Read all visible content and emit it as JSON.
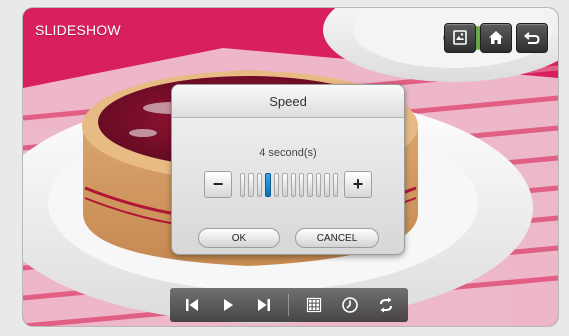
{
  "screen": {
    "title": "SLIDESHOW"
  },
  "top_buttons": [
    {
      "icon": "photo-frame-icon"
    },
    {
      "icon": "home-icon"
    },
    {
      "icon": "back-icon"
    }
  ],
  "speed_dialog": {
    "title": "Speed",
    "value_text": "4 second(s)",
    "minus_label": "−",
    "plus_label": "+",
    "level": 4,
    "level_max": 12,
    "ok_label": "OK",
    "cancel_label": "CANCEL"
  },
  "playback_bar": [
    {
      "icon": "previous-icon"
    },
    {
      "icon": "play-icon"
    },
    {
      "icon": "next-icon"
    },
    {
      "icon": "grid-icon"
    },
    {
      "icon": "clock-icon"
    },
    {
      "icon": "repeat-icon"
    }
  ],
  "colors": {
    "background": "#d9205e",
    "accent_blue": "#1a86cf"
  }
}
